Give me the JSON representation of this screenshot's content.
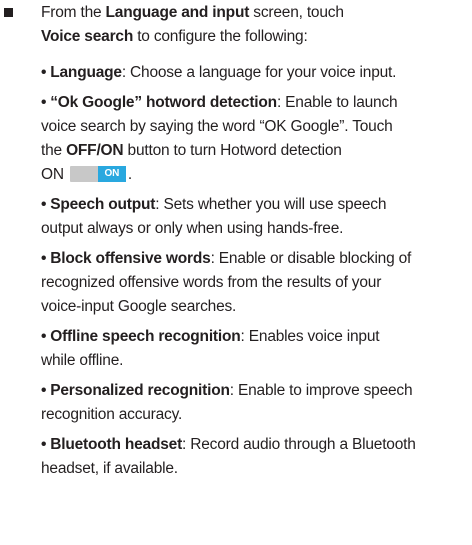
{
  "intro": {
    "line1_prefix": "From the ",
    "line1_bold": "Language and input",
    "line1_suffix": " screen, touch",
    "line2_bold": "Voice search",
    "line2_suffix": " to configure the following:"
  },
  "items": [
    {
      "term": "Language",
      "lines": [
        ": Choose a language for your voice input."
      ]
    },
    {
      "term": "“Ok Google” hotword detection",
      "lines": [
        ": Enable to launch",
        "voice search by saying the word “OK Google”. Touch"
      ]
    },
    {
      "term": "Speech output",
      "lines": [
        ": Sets whether you will use speech",
        "output always or only when using hands-free."
      ]
    },
    {
      "term": "Block offensive words",
      "lines": [
        ": Enable or disable blocking of",
        "recognized offensive words from the results of your",
        "voice-input Google searches."
      ]
    },
    {
      "term": "Offline speech recognition",
      "lines": [
        ": Enables voice input",
        "while offline."
      ]
    },
    {
      "term": "Personalized recognition",
      "lines": [
        ": Enable to improve speech",
        "recognition accuracy."
      ]
    },
    {
      "term": "Bluetooth headset",
      "lines": [
        ": Record audio through a Bluetooth",
        "headset, if available."
      ]
    }
  ],
  "hotword_extra": {
    "the": "the ",
    "button_bold": "OFF/ON",
    "rest": " button to turn Hotword detection",
    "on_label": "ON",
    "toggle_label": "ON",
    "toggle_state": "on",
    "period": "."
  },
  "colors": {
    "text": "#231f20",
    "toggle_on": "#29a8df",
    "toggle_track": "#c8c8c8"
  }
}
